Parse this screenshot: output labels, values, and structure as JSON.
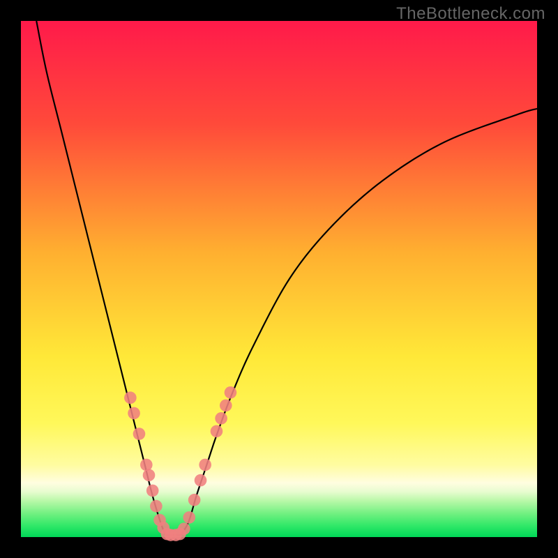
{
  "watermark": "TheBottleneck.com",
  "chart_data": {
    "type": "line",
    "title": "",
    "xlabel": "",
    "ylabel": "",
    "x_range": [
      0,
      100
    ],
    "y_range": [
      0,
      100
    ],
    "grid": false,
    "series": [
      {
        "name": "left-branch",
        "x": [
          3,
          5,
          8,
          12,
          16,
          19,
          21,
          22.5,
          24,
          25.5,
          27,
          28
        ],
        "y": [
          100,
          90,
          78,
          62,
          46,
          34,
          26,
          20,
          14,
          8,
          3,
          0.4
        ]
      },
      {
        "name": "right-branch",
        "x": [
          31,
          32.5,
          34,
          36,
          38,
          41,
          45,
          52,
          60,
          70,
          82,
          96,
          100
        ],
        "y": [
          0.4,
          3,
          8,
          14,
          20,
          28,
          37,
          50,
          60,
          69,
          76.5,
          81.8,
          83
        ]
      }
    ],
    "flat_bottom": {
      "x": [
        28,
        31
      ],
      "y": [
        0.4,
        0.4
      ]
    },
    "markers": {
      "name": "data-points",
      "color": "#f08080",
      "points": [
        {
          "x": 21.2,
          "y": 27.0
        },
        {
          "x": 21.9,
          "y": 24.0
        },
        {
          "x": 22.9,
          "y": 20.0
        },
        {
          "x": 24.3,
          "y": 14.0
        },
        {
          "x": 24.8,
          "y": 12.0
        },
        {
          "x": 25.5,
          "y": 9.0
        },
        {
          "x": 26.2,
          "y": 6.0
        },
        {
          "x": 26.9,
          "y": 3.3
        },
        {
          "x": 27.6,
          "y": 1.8
        },
        {
          "x": 28.3,
          "y": 0.6
        },
        {
          "x": 29.0,
          "y": 0.4
        },
        {
          "x": 30.0,
          "y": 0.4
        },
        {
          "x": 30.8,
          "y": 0.6
        },
        {
          "x": 31.6,
          "y": 1.6
        },
        {
          "x": 32.6,
          "y": 3.8
        },
        {
          "x": 33.6,
          "y": 7.2
        },
        {
          "x": 34.8,
          "y": 11.0
        },
        {
          "x": 35.7,
          "y": 14.0
        },
        {
          "x": 37.9,
          "y": 20.5
        },
        {
          "x": 38.8,
          "y": 23.0
        },
        {
          "x": 39.7,
          "y": 25.5
        },
        {
          "x": 40.6,
          "y": 28.0
        }
      ]
    },
    "background_gradient": {
      "stops": [
        {
          "offset": 0.0,
          "color": "#ff1a4a"
        },
        {
          "offset": 0.2,
          "color": "#ff4a3a"
        },
        {
          "offset": 0.45,
          "color": "#ffb030"
        },
        {
          "offset": 0.65,
          "color": "#ffe838"
        },
        {
          "offset": 0.78,
          "color": "#fff85a"
        },
        {
          "offset": 0.86,
          "color": "#fffca0"
        },
        {
          "offset": 0.895,
          "color": "#fffde0"
        },
        {
          "offset": 0.912,
          "color": "#e8fcd0"
        },
        {
          "offset": 0.93,
          "color": "#b8f8a8"
        },
        {
          "offset": 0.955,
          "color": "#70f080"
        },
        {
          "offset": 0.978,
          "color": "#30e868"
        },
        {
          "offset": 1.0,
          "color": "#00d858"
        }
      ]
    }
  }
}
